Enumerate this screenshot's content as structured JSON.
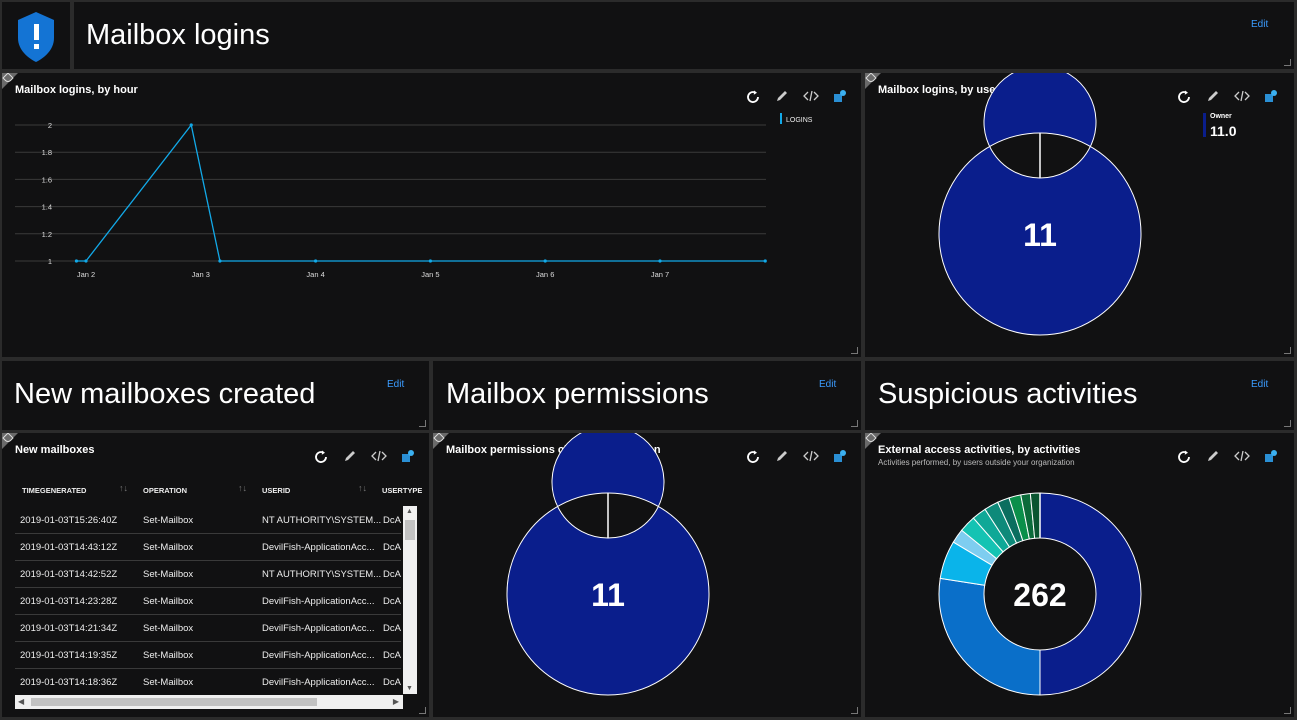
{
  "header": {
    "title": "Mailbox logins",
    "edit_label": "Edit"
  },
  "sections": [
    {
      "title": "New mailboxes created",
      "edit_label": "Edit"
    },
    {
      "title": "Mailbox permissions",
      "edit_label": "Edit"
    },
    {
      "title": "Suspicious activities",
      "edit_label": "Edit"
    }
  ],
  "tiles": {
    "logins_by_hour": {
      "title": "Mailbox logins, by hour",
      "legend": "LOGINS"
    },
    "logins_by_usertype": {
      "title": "Mailbox logins, by user type",
      "legend_name": "Owner",
      "legend_value": "11.0",
      "center": "11"
    },
    "new_mailboxes": {
      "title": "New mailboxes"
    },
    "permission_changes": {
      "title": "Mailbox permissions changes, by reason",
      "center": "11"
    },
    "external_access": {
      "title": "External access activities, by activities",
      "subtitle": "Activities performed, by users outside your organization",
      "center": "262"
    }
  },
  "icons": {
    "shield": "shield-alert-icon",
    "refresh": "refresh-icon",
    "edit": "pencil-icon",
    "code": "code-icon",
    "pin": "pin-icon"
  },
  "colors": {
    "accent": "#3b9cff",
    "line": "#12a9e8",
    "donut_main": "#0a1e8c"
  },
  "chart_data": [
    {
      "type": "line",
      "title": "Mailbox logins, by hour",
      "series": [
        {
          "name": "LOGINS",
          "x": [
            "Jan 1 22:00",
            "Jan 2 00:00",
            "Jan 2 22:00",
            "Jan 3 04:00",
            "Jan 4 00:00",
            "Jan 5 00:00",
            "Jan 6 00:00",
            "Jan 7 00:00",
            "Jan 7 22:00"
          ],
          "values": [
            1,
            1,
            2,
            1,
            1,
            1,
            1,
            1,
            1
          ]
        }
      ],
      "x_ticks": [
        "Jan 2",
        "Jan 3",
        "Jan 4",
        "Jan 5",
        "Jan 6",
        "Jan 7"
      ],
      "y_ticks": [
        "1",
        "1.2",
        "1.4",
        "1.6",
        "1.8",
        "2"
      ],
      "ylim": [
        1,
        2
      ],
      "grid": true,
      "legend_position": "top-right"
    },
    {
      "type": "pie",
      "title": "Mailbox logins, by user type",
      "labels": [
        "Owner"
      ],
      "values": [
        11
      ],
      "center_label": "11",
      "colors": [
        "#0a1e8c"
      ]
    },
    {
      "type": "pie",
      "title": "Mailbox permissions changes, by reason",
      "values": [
        11
      ],
      "center_label": "11",
      "colors": [
        "#0a1e8c"
      ]
    },
    {
      "type": "pie",
      "title": "External access activities, by activities",
      "values": [
        131,
        72,
        16,
        6,
        7,
        6,
        6,
        5,
        5,
        4,
        4
      ],
      "center_label": "262",
      "colors": [
        "#0a1e8c",
        "#0a6fc9",
        "#0ab4ea",
        "#7ecdf0",
        "#14c3b3",
        "#0fa897",
        "#0e8a7a",
        "#0b6e5f",
        "#0a8f4a",
        "#0b6b3a",
        "#0a5530"
      ]
    }
  ],
  "table": {
    "columns": [
      "TIMEGENERATED",
      "OPERATION",
      "USERID",
      "USERTYPE"
    ],
    "rows": [
      [
        "2019-01-03T15:26:40Z",
        "Set-Mailbox",
        "NT AUTHORITY\\SYSTEM...",
        "DcA"
      ],
      [
        "2019-01-03T14:43:12Z",
        "Set-Mailbox",
        "DevilFish-ApplicationAcc...",
        "DcA"
      ],
      [
        "2019-01-03T14:42:52Z",
        "Set-Mailbox",
        "NT AUTHORITY\\SYSTEM...",
        "DcA"
      ],
      [
        "2019-01-03T14:23:28Z",
        "Set-Mailbox",
        "DevilFish-ApplicationAcc...",
        "DcA"
      ],
      [
        "2019-01-03T14:21:34Z",
        "Set-Mailbox",
        "DevilFish-ApplicationAcc...",
        "DcA"
      ],
      [
        "2019-01-03T14:19:35Z",
        "Set-Mailbox",
        "DevilFish-ApplicationAcc...",
        "DcA"
      ],
      [
        "2019-01-03T14:18:36Z",
        "Set-Mailbox",
        "DevilFish-ApplicationAcc...",
        "DcA"
      ]
    ]
  }
}
